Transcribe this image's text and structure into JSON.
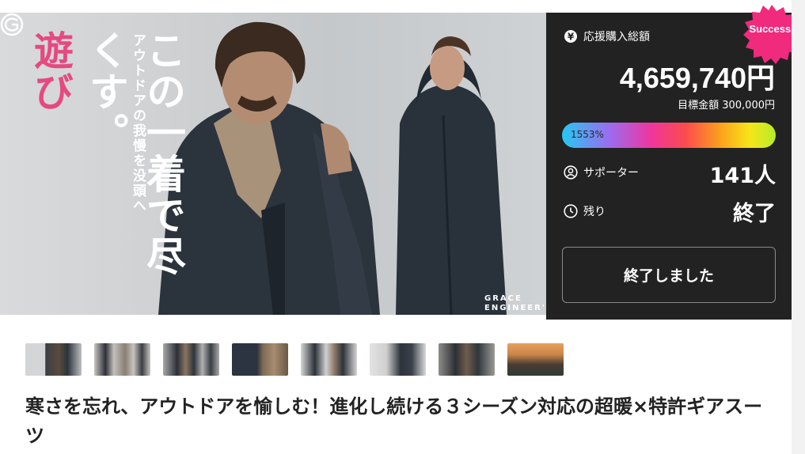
{
  "hero": {
    "tagline_pink": "遊び",
    "tagline_main": "この一着で尽くす。",
    "tagline_small": "アウトドアの我慢を没頭へ",
    "brand_line1": "GRACE",
    "brand_line2": "ENGINEER'S"
  },
  "panel": {
    "badge": "Success!",
    "total_label": "応援購入総額",
    "total_amount": "4,659,740円",
    "goal_text": "目標金額 300,000円",
    "progress_label": "1553%",
    "progress_percent": 1553,
    "supporters_label": "サポーター",
    "supporters_value": "141人",
    "remaining_label": "残り",
    "remaining_value": "終了",
    "ended_button": "終了しました",
    "colors": {
      "panel_bg": "#222222",
      "badge": "#f02a7c",
      "accent_pink": "#e54a7f"
    },
    "icons": [
      "yen-icon",
      "user-icon",
      "clock-icon"
    ]
  },
  "thumbnails": [
    {
      "name": "thumbnail-1"
    },
    {
      "name": "thumbnail-2"
    },
    {
      "name": "thumbnail-3"
    },
    {
      "name": "thumbnail-4"
    },
    {
      "name": "thumbnail-5"
    },
    {
      "name": "thumbnail-6"
    },
    {
      "name": "thumbnail-7"
    },
    {
      "name": "thumbnail-8"
    }
  ],
  "project": {
    "title": "寒さを忘れ、アウトドアを愉しむ！進化し続ける３シーズン対応の超暖×特許ギアスーツ"
  }
}
